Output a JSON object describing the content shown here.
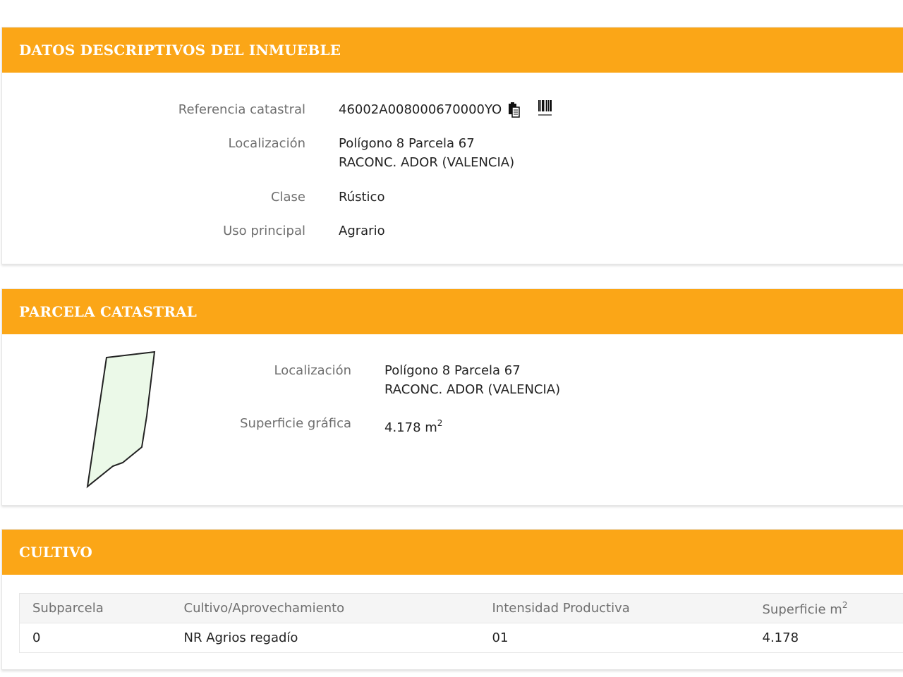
{
  "datos": {
    "title": "DATOS DESCRIPTIVOS DEL INMUEBLE",
    "referencia_label": "Referencia catastral",
    "referencia_value": "46002A008000670000YO",
    "localizacion_label": "Localización",
    "localizacion_line1": "Polígono 8 Parcela 67",
    "localizacion_line2": "RACONC. ADOR (VALENCIA)",
    "clase_label": "Clase",
    "clase_value": "Rústico",
    "uso_label": "Uso principal",
    "uso_value": "Agrario"
  },
  "parcela": {
    "title": "PARCELA CATASTRAL",
    "localizacion_label": "Localización",
    "localizacion_line1": "Polígono 8 Parcela 67",
    "localizacion_line2": "RACONC. ADOR (VALENCIA)",
    "superficie_label": "Superficie gráfica",
    "superficie_value": "4.178 m",
    "superficie_exp": "2"
  },
  "cultivo": {
    "title": "CULTIVO",
    "columns": [
      "Subparcela",
      "Cultivo/Aprovechamiento",
      "Intensidad Productiva",
      "Superficie m"
    ],
    "superficie_col_exp": "2",
    "rows": [
      [
        "0",
        "NR Agrios regadío",
        "01",
        "4.178"
      ]
    ]
  },
  "colors": {
    "header": "#fba617",
    "parcel_fill": "#ebf9e8"
  }
}
